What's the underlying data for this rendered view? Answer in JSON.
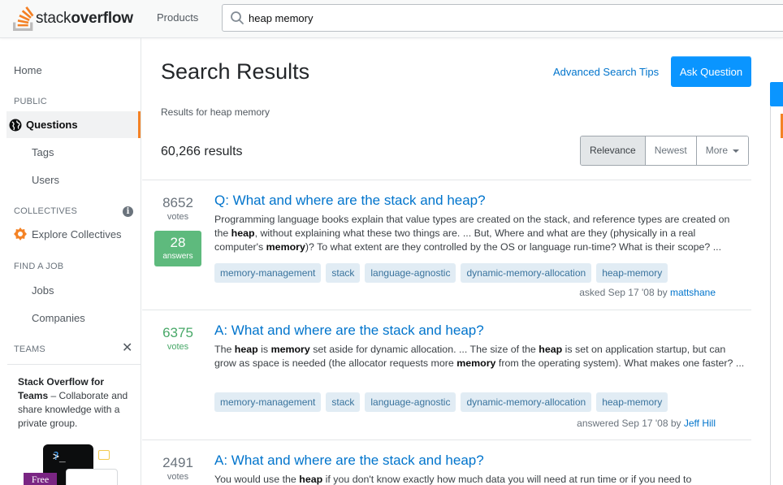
{
  "topbar": {
    "logo_regular": "stack",
    "logo_bold": "overflow",
    "products_label": "Products",
    "search_value": "heap memory"
  },
  "sidebar": {
    "home": "Home",
    "public_label": "PUBLIC",
    "questions": "Questions",
    "tags": "Tags",
    "users": "Users",
    "collectives_label": "COLLECTIVES",
    "info_glyph": "i",
    "explore_collectives": "Explore Collectives",
    "find_job_label": "FIND A JOB",
    "jobs": "Jobs",
    "companies": "Companies",
    "teams_label": "TEAMS",
    "close_glyph": "✕",
    "teams_promo_bold": "Stack Overflow for Teams",
    "teams_promo_text": " – Collaborate and share knowledge with a private group.",
    "teams_illus_prompt": ">_",
    "teams_illus_q": "?",
    "free_badge": "Free"
  },
  "main": {
    "title": "Search Results",
    "advanced_tips": "Advanced Search Tips",
    "ask_button": "Ask Question",
    "results_for_prefix": "Results for ",
    "results_for_query": "heap memory",
    "results_count": "60,266 results",
    "sort": {
      "relevance": "Relevance",
      "newest": "Newest",
      "more": "More"
    }
  },
  "results": [
    {
      "votes": "8652",
      "votes_label": "votes",
      "answers": "28",
      "answers_label": "answers",
      "title": "Q: What and where are the stack and heap?",
      "excerpt_html": "Programming language books explain that value types are created on the stack, and reference types are created on the <b>heap</b>, without explaining what these two things are. ... But, Where and what are they (physically in a real computer's <b>memory</b>)? To what extent are they controlled by the OS or language run-time? What is their scope? ...",
      "tags": [
        "memory-management",
        "stack",
        "language-agnostic",
        "dynamic-memory-allocation",
        "heap-memory"
      ],
      "meta_prefix": "asked Sep 17 '08 by ",
      "author": "mattshane"
    },
    {
      "votes": "6375",
      "votes_label": "votes",
      "title": "A: What and where are the stack and heap?",
      "excerpt_html": "The <b>heap</b> is <b>memory</b> set aside for dynamic allocation. ... The size of the <b>heap</b> is set on application startup, but can grow as space is needed (the allocator requests more <b>memory</b> from the operating system). What makes one faster? ...",
      "tags": [
        "memory-management",
        "stack",
        "language-agnostic",
        "dynamic-memory-allocation",
        "heap-memory"
      ],
      "meta_prefix": "answered Sep 17 '08 by ",
      "author": "Jeff Hill"
    },
    {
      "votes": "2491",
      "votes_label": "votes",
      "title": "A: What and where are the stack and heap?",
      "excerpt_html": "You would use the <b>heap</b> if you don't know exactly how much data you will need at run time or if you need to"
    }
  ],
  "colors": {
    "accent_orange": "#f48225",
    "link_blue": "#0074cc",
    "button_blue": "#0a95ff",
    "answer_green": "#5eba7d",
    "tag_bg": "#e1ecf4",
    "tag_text": "#39739d"
  }
}
